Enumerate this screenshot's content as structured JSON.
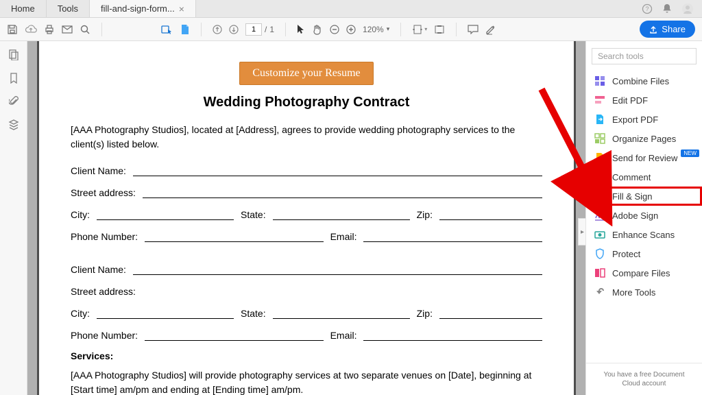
{
  "tabs": {
    "home": "Home",
    "tools": "Tools",
    "file": "fill-and-sign-form..."
  },
  "toolbar": {
    "page_current": "1",
    "page_total": "1",
    "zoom": "120%",
    "share": "Share"
  },
  "right": {
    "search_placeholder": "Search tools",
    "items": [
      {
        "id": "combine",
        "label": "Combine Files",
        "color": "#6a5ee6"
      },
      {
        "id": "edit",
        "label": "Edit PDF",
        "color": "#f06292"
      },
      {
        "id": "export",
        "label": "Export PDF",
        "color": "#29b6f6"
      },
      {
        "id": "organize",
        "label": "Organize Pages",
        "color": "#9ccc65"
      },
      {
        "id": "review",
        "label": "Send for Review",
        "color": "#ffb300",
        "new": true
      },
      {
        "id": "comment",
        "label": "Comment",
        "color": "#ffb300"
      },
      {
        "id": "fillsign",
        "label": "Fill & Sign",
        "color": "#8e6bd4",
        "highlight": true
      },
      {
        "id": "adobesign",
        "label": "Adobe Sign",
        "color": "#8e6bd4"
      },
      {
        "id": "enhance",
        "label": "Enhance Scans",
        "color": "#26a69a"
      },
      {
        "id": "protect",
        "label": "Protect",
        "color": "#42a5f5"
      },
      {
        "id": "compare",
        "label": "Compare Files",
        "color": "#ec407a"
      },
      {
        "id": "more",
        "label": "More Tools",
        "color": "#888888"
      }
    ],
    "new_badge": "NEW",
    "footer1": "You have a free Document",
    "footer2": "Cloud account"
  },
  "doc": {
    "resume_btn": "Customize your Resume",
    "title": "Wedding Photography Contract",
    "intro": "[AAA Photography Studios], located at [Address], agrees to provide wedding photography services to the client(s) listed below.",
    "labels": {
      "client": "Client Name:",
      "street": "Street address:",
      "city": "City:",
      "state": "State:",
      "zip": "Zip:",
      "phone": "Phone Number:",
      "email": "Email:"
    },
    "services_head": "Services:",
    "services_body": "[AAA Photography Studios] will provide photography services at two separate venues on [Date], beginning at [Start time] am/pm and ending at [Ending time] am/pm."
  }
}
